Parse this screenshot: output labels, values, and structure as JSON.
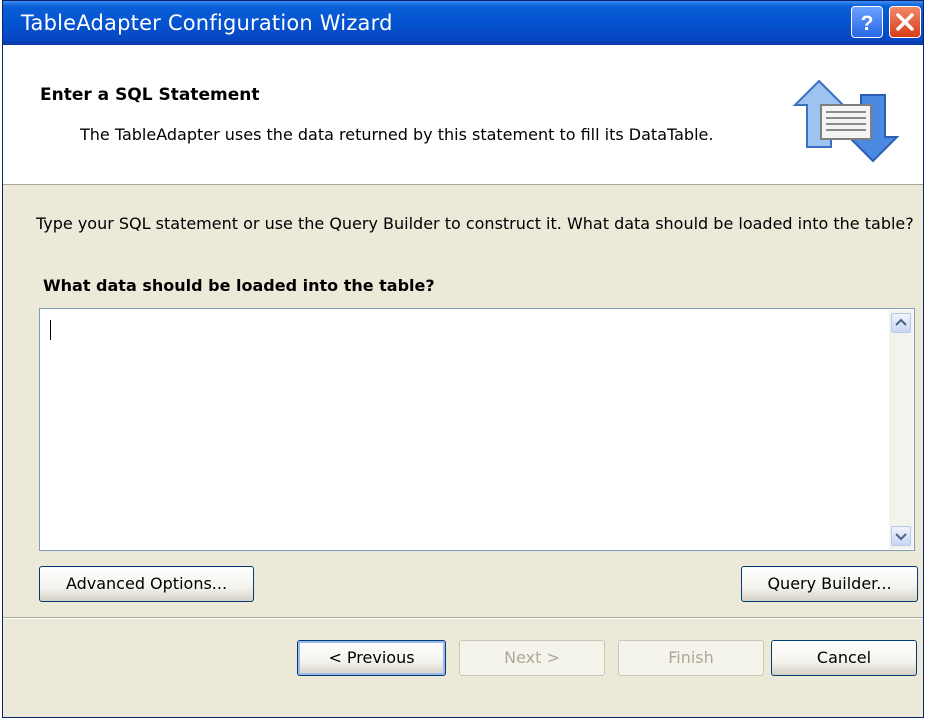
{
  "window": {
    "title": "TableAdapter Configuration Wizard",
    "help_icon": "question-mark-icon",
    "close_icon": "close-x-icon"
  },
  "header": {
    "title": "Enter a SQL Statement",
    "description": "The TableAdapter uses the data returned by this statement to fill its DataTable.",
    "icon": "data-transfer-arrows-icon"
  },
  "body": {
    "instruction": "Type your SQL statement or use the Query Builder to construct it. What data should be loaded into the table?",
    "question": "What data should be loaded into the table?",
    "sql_value": ""
  },
  "buttons": {
    "advanced": "Advanced Options...",
    "query_builder": "Query Builder...",
    "previous": "< Previous",
    "next": "Next >",
    "finish": "Finish",
    "cancel": "Cancel"
  },
  "colors": {
    "titlebar": "#0553d0",
    "dialog_bg": "#ece9d8",
    "header_bg": "#ffffff",
    "button_border": "#003c74"
  }
}
